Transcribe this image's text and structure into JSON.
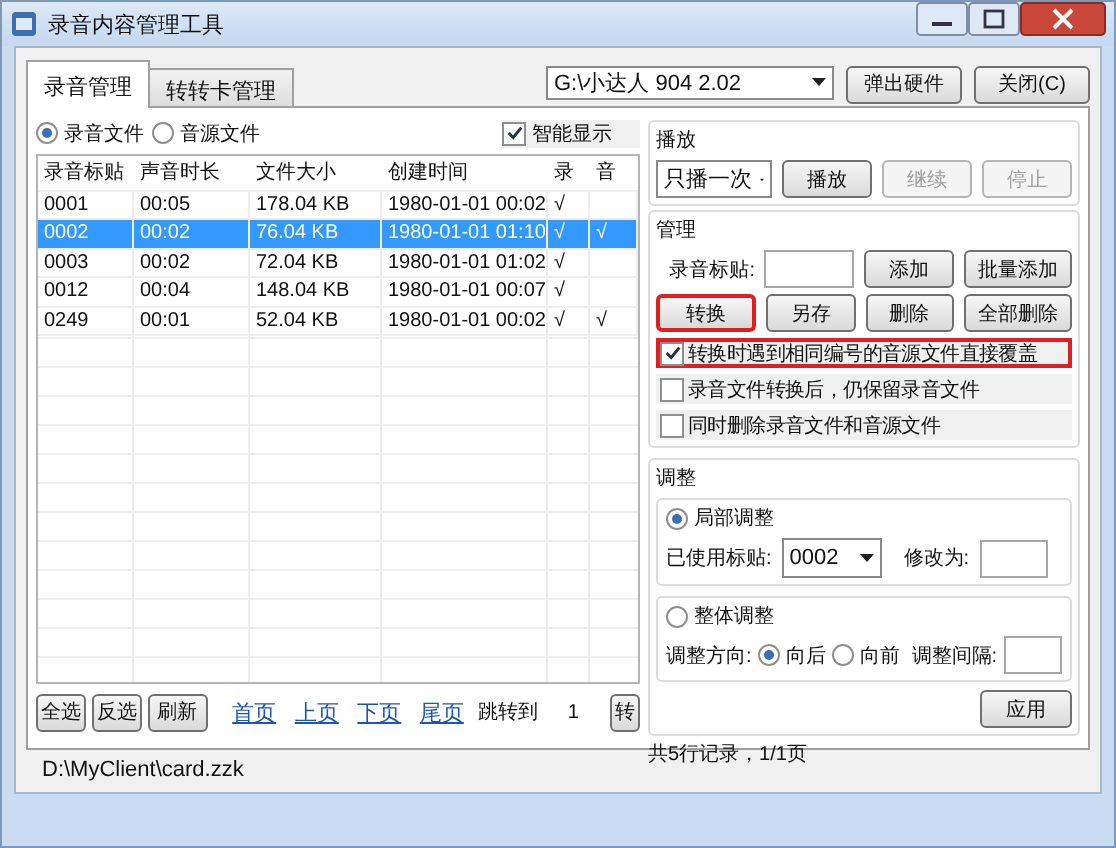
{
  "window": {
    "title": "录音内容管理工具"
  },
  "tabs": [
    {
      "label": "录音管理",
      "selected": true
    },
    {
      "label": "转转卡管理",
      "selected": false
    }
  ],
  "drive_select": {
    "value": "G:\\小达人 904 2.02"
  },
  "top_buttons": [
    "弹出硬件",
    "关闭(C)"
  ],
  "file_type": [
    {
      "label": "录音文件",
      "selected": true
    },
    {
      "label": "音源文件",
      "selected": false
    }
  ],
  "smart_display": {
    "label": "智能显示",
    "checked": true
  },
  "table": {
    "columns": [
      "录音标贴",
      "声音时长",
      "文件大小",
      "创建时间",
      "录",
      "音"
    ],
    "rows": [
      {
        "cells": [
          "0001",
          "00:05",
          "178.04 KB",
          "1980-01-01 00:02",
          "√"
        ],
        "selected": false
      },
      {
        "cells": [
          "0002",
          "00:02",
          "76.04 KB",
          "1980-01-01 01:10",
          "√",
          "√"
        ],
        "selected": true
      },
      {
        "cells": [
          "0003",
          "00:02",
          "72.04 KB",
          "1980-01-01 01:02",
          "√"
        ],
        "selected": false
      },
      {
        "cells": [
          "0012",
          "00:04",
          "148.04 KB",
          "1980-01-01 00:07",
          "√"
        ],
        "selected": false
      },
      {
        "cells": [
          "0249",
          "00:01",
          "52.04 KB",
          "1980-01-01 00:02",
          "√",
          "√"
        ],
        "selected": false
      }
    ]
  },
  "bottom_buttons": [
    "全选",
    "反选",
    "刷新"
  ],
  "pager_links": [
    "首页",
    "上页",
    "下页",
    "尾页"
  ],
  "jump": {
    "label": "跳转到",
    "value": "1",
    "button": "转"
  },
  "record_info": "共5行记录，1/1页",
  "playback": {
    "title": "播放",
    "mode": "只播一次",
    "buttons": [
      {
        "label": "播放",
        "disabled": false
      },
      {
        "label": "继续",
        "disabled": true
      },
      {
        "label": "停止",
        "disabled": true
      }
    ]
  },
  "manage": {
    "title": "管理",
    "field_label": "录音标贴:",
    "buttons": [
      {
        "label": "添加",
        "highlighted": false
      },
      {
        "label": "批量添加",
        "highlighted": false
      },
      {
        "label": "转换",
        "highlighted": true
      },
      {
        "label": "另存",
        "highlighted": false
      },
      {
        "label": "删除",
        "highlighted": false
      },
      {
        "label": "全部删除",
        "highlighted": false
      }
    ],
    "options": [
      {
        "label": "转换时遇到相同编号的音源文件直接覆盖",
        "checked": true,
        "highlighted": true
      },
      {
        "label": "录音文件转换后，仍保留录音文件",
        "checked": false,
        "highlighted": false
      },
      {
        "label": "同时删除录音文件和音源文件",
        "checked": false,
        "highlighted": false
      }
    ]
  },
  "adjust": {
    "title": "调整",
    "local": {
      "label": "局部调整",
      "selected": true,
      "used_label": "已使用标贴:",
      "used_value": "0002",
      "change_label": "修改为:"
    },
    "global": {
      "label": "整体调整",
      "selected": false,
      "direction_label": "调整方向:",
      "directions": [
        {
          "label": "向后",
          "selected": true
        },
        {
          "label": "向前",
          "selected": false
        }
      ],
      "interval_label": "调整间隔:"
    },
    "apply": "应用"
  },
  "status_bar": {
    "path": "D:\\MyClient\\card.zzk"
  }
}
